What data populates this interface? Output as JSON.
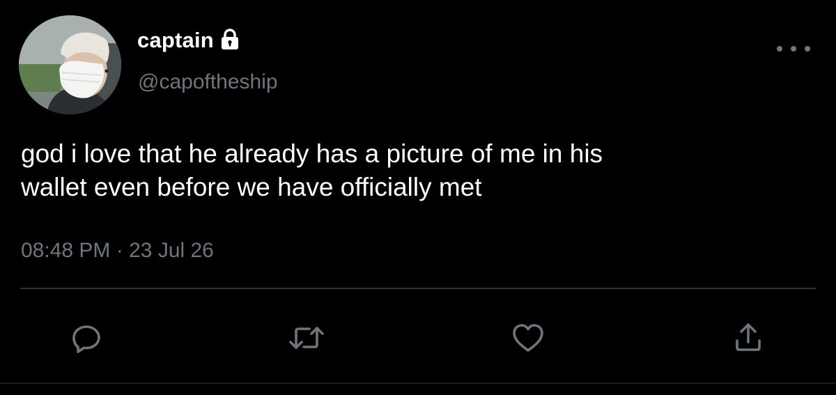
{
  "tweet": {
    "display_name": "captain",
    "handle": "@capoftheship",
    "text_lines": [
      "god i love that he already has a picture of me in his",
      "wallet even before we have officially met"
    ],
    "time": "08:48 PM",
    "separator": "·",
    "date": "23 Jul 26"
  },
  "icons": {
    "protected": "lock-icon",
    "more": "more-icon",
    "reply": "reply-icon",
    "retweet": "retweet-icon",
    "like": "heart-icon",
    "share": "share-icon"
  },
  "colors": {
    "background": "#000000",
    "primary_text": "#ffffff",
    "secondary_text": "#6e767d",
    "divider": "#2f3336"
  }
}
